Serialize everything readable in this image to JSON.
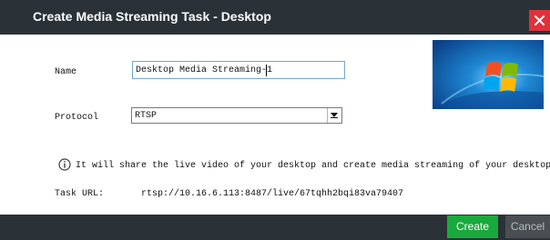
{
  "dialog": {
    "title": "Create Media Streaming Task - Desktop",
    "close_icon": "close-icon"
  },
  "form": {
    "name_label": "Name",
    "name_value": "Desktop Media Streaming-1",
    "protocol_label": "Protocol",
    "protocol_value": "RTSP"
  },
  "info": {
    "icon": "info-icon",
    "text": "It will share the live video of your desktop and create media streaming of your desktop."
  },
  "task_url": {
    "label": "Task URL:",
    "value": "rtsp://10.16.6.113:8487/live/67tqhh2bqi83va79407"
  },
  "footer": {
    "create_label": "Create",
    "cancel_label": "Cancel"
  },
  "colors": {
    "titlebar_bg": "#2b3237",
    "close_bg": "#e0313b",
    "create_bg": "#1aa93d",
    "cancel_bg": "#4a4f54"
  }
}
